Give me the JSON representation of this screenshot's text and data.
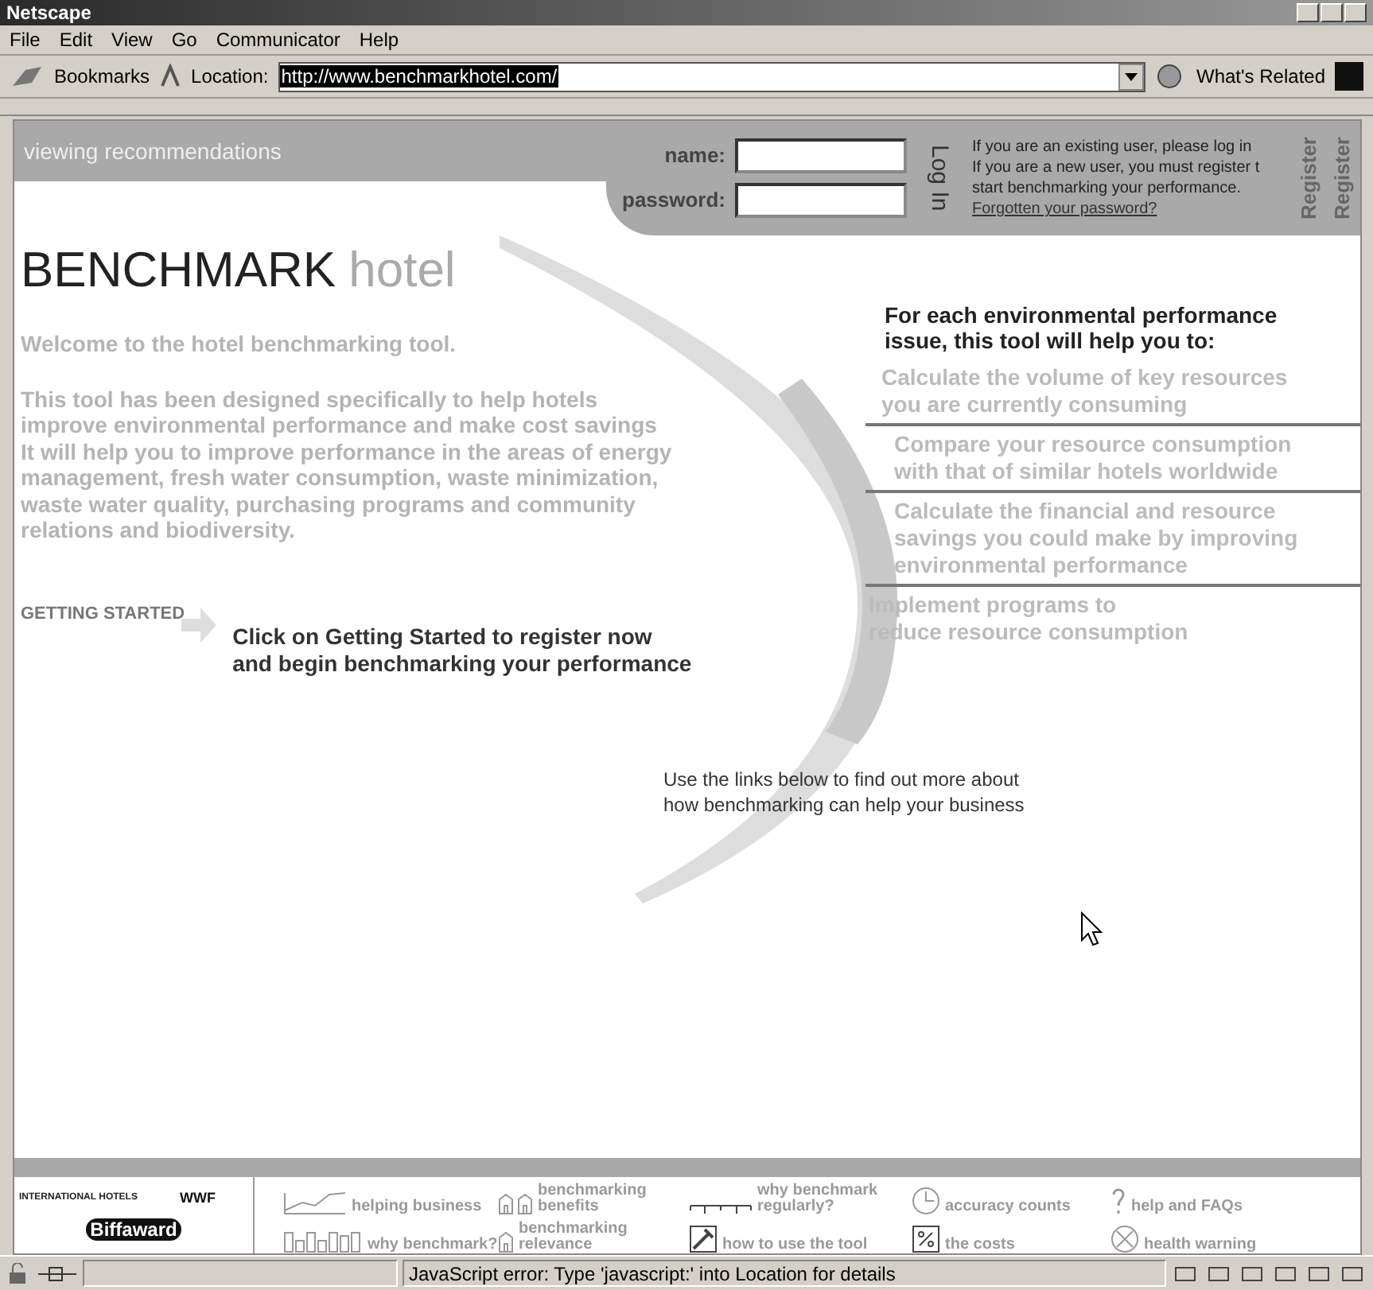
{
  "window": {
    "title": "Netscape"
  },
  "menu": [
    "File",
    "Edit",
    "View",
    "Go",
    "Communicator",
    "Help"
  ],
  "toolbar": {
    "bookmarks": "Bookmarks",
    "location_label": "Location:",
    "url": "http://www.benchmarkhotel.com/",
    "related": "What's Related"
  },
  "header": {
    "section": "viewing recommendations",
    "name_label": "name:",
    "password_label": "password:",
    "login": "Log In",
    "info": [
      "If you are an existing user, please log in",
      "If you are a new user, you must register t",
      "start benchmarking your performance."
    ],
    "forgot": "Forgotten your password?",
    "register": [
      "Register",
      "Register"
    ]
  },
  "logo": {
    "bold": "BENCHMARK",
    "light": "hotel"
  },
  "welcome": "Welcome to the hotel benchmarking tool.",
  "intro": [
    "This tool has been designed specifically to help hotels",
    "improve environmental performance and make cost savings",
    "It will help you to improve performance in the areas of energy",
    "management, fresh water consumption, waste minimization,",
    "waste water quality, purchasing programs and community",
    "relations and biodiversity."
  ],
  "getting_started": {
    "label": "GETTING STARTED",
    "text": [
      "Click on Getting Started to register now",
      "and begin benchmarking your performance"
    ]
  },
  "benefits": {
    "heading": [
      "For each environmental performance",
      "issue, this tool will help you to:"
    ],
    "items": [
      [
        "Calculate the volume of key resources",
        "you are currently consuming"
      ],
      [
        "Compare your resource consumption",
        "with that of similar hotels worldwide"
      ],
      [
        "Calculate the financial and resource",
        "savings you could make by improving",
        "environmental performance"
      ],
      [
        "Implement programs to",
        "reduce resource consumption"
      ]
    ]
  },
  "links_note": [
    "Use the links below to find out more about",
    "how benchmarking can help your business"
  ],
  "partners": [
    {
      "kind": "ihei",
      "text": "INTERNATIONAL HOTELS"
    },
    {
      "kind": "wwf",
      "text": "WWF"
    },
    {
      "kind": "biffa",
      "text": "Biffaward"
    }
  ],
  "footer_links": [
    {
      "kind": "line",
      "label": [
        "helping business"
      ]
    },
    {
      "kind": "houses",
      "label": [
        "benchmarking",
        "benefits"
      ]
    },
    {
      "kind": "ruler",
      "label": [
        "why benchmark",
        "regularly?"
      ]
    },
    {
      "kind": "clock",
      "label": [
        "accuracy counts"
      ]
    },
    {
      "kind": "question",
      "label": [
        "help and FAQs"
      ]
    },
    {
      "kind": "bars",
      "label": [
        "why benchmark?"
      ]
    },
    {
      "kind": "house",
      "label": [
        "benchmarking",
        "relevance"
      ]
    },
    {
      "kind": "wrench",
      "label": [
        "how to use the tool"
      ]
    },
    {
      "kind": "percent",
      "label": [
        "the costs"
      ]
    },
    {
      "kind": "cross",
      "label": [
        "health warning"
      ]
    }
  ],
  "status": "JavaScript error: Type 'javascript:' into Location for details"
}
